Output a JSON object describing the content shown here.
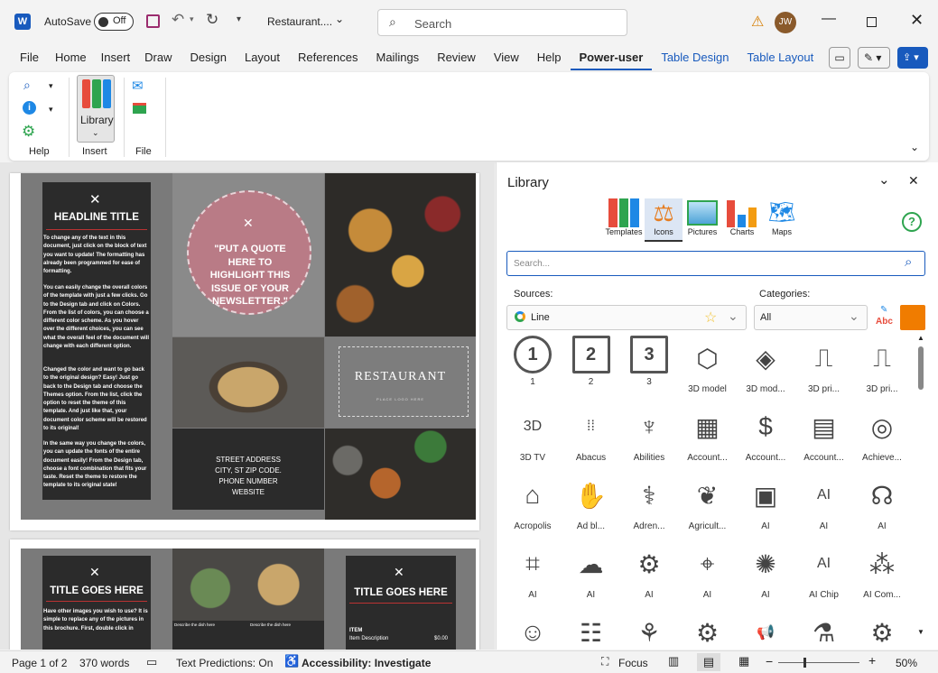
{
  "titlebar": {
    "autosave_label": "AutoSave",
    "autosave_state": "Off",
    "doc_title": "Restaurant....",
    "search_placeholder": "Search",
    "user_initials": "JW"
  },
  "menu": {
    "items": [
      "File",
      "Home",
      "Insert",
      "Draw",
      "Design",
      "Layout",
      "References",
      "Mailings",
      "Review",
      "View",
      "Help",
      "Power-user",
      "Table Design",
      "Table Layout"
    ]
  },
  "ribbon": {
    "groups": [
      {
        "label": "Help"
      },
      {
        "label": "Insert"
      },
      {
        "label": "File"
      }
    ],
    "library_label": "Library"
  },
  "document": {
    "headline": "HEADLINE TITLE",
    "body_text": [
      "To change any of the text in this document, just click on the block of text you want to update! The formatting has already been programmed for ease of formatting.",
      "You can easily change the overall colors of the template with just a few clicks. Go to the Design tab and click on Colors. From the list of colors, you can choose a different color scheme. As you hover over the different choices, you can see what the overall feel of the document will change with each different option.",
      "Changed the color and want to go back to the original design? Easy! Just go back to the Design tab and choose the Themes option. From the list, click the option to reset the theme of this template. And just like that, your document color scheme will be restored to its original!",
      "In the same way you change the colors, you can update the fonts of the entire document easily! From the Design tab, choose a font combination that fits your taste. Reset the theme to restore the template to its original state!"
    ],
    "quote": "\"PUT A QUOTE HERE TO HIGHLIGHT THIS ISSUE OF YOUR NEWSLETTER.\"",
    "restaurant": "RESTAURANT",
    "logo_sub": "PLACE LOGO HERE",
    "address": [
      "STREET ADDRESS",
      "CITY, ST ZIP CODE.",
      "PHONE NUMBER",
      "WEBSITE"
    ],
    "page2_title_left": "TITLE GOES HERE",
    "page2_title_right": "TITLE GOES HERE",
    "page2_text": "Have other images you wish to use? It is simple to replace any of the pictures in this brochure. First, double click in",
    "dish1": "Describe the dish here",
    "dish2": "Describe the dish here",
    "item_label": "ITEM",
    "item_desc": "Item Description",
    "item_price": "$0.00"
  },
  "library": {
    "title": "Library",
    "tabs": [
      "Templates",
      "Icons",
      "Pictures",
      "Charts",
      "Maps"
    ],
    "search_placeholder": "Search...",
    "sources_label": "Sources:",
    "categories_label": "Categories:",
    "source_value": "Line",
    "category_value": "All",
    "abc_label": "Abc",
    "icons": [
      {
        "label": "1",
        "glyph": "1"
      },
      {
        "label": "2",
        "glyph": "2"
      },
      {
        "label": "3",
        "glyph": "3"
      },
      {
        "label": "3D model",
        "glyph": "⬡"
      },
      {
        "label": "3D mod...",
        "glyph": "◈"
      },
      {
        "label": "3D pri...",
        "glyph": "⎍"
      },
      {
        "label": "3D pri...",
        "glyph": "⎍"
      },
      {
        "label": "3D TV",
        "glyph": "3D"
      },
      {
        "label": "Abacus",
        "glyph": "⁞⁞"
      },
      {
        "label": "Abilities",
        "glyph": "♆"
      },
      {
        "label": "Account...",
        "glyph": "▦"
      },
      {
        "label": "Account...",
        "glyph": "$"
      },
      {
        "label": "Account...",
        "glyph": "▤"
      },
      {
        "label": "Achieve...",
        "glyph": "◎"
      },
      {
        "label": "Acropolis",
        "glyph": "⌂"
      },
      {
        "label": "Ad bl...",
        "glyph": "✋"
      },
      {
        "label": "Adren...",
        "glyph": "⚕"
      },
      {
        "label": "Agricult...",
        "glyph": "❦"
      },
      {
        "label": "AI",
        "glyph": "▣"
      },
      {
        "label": "AI",
        "glyph": "AI"
      },
      {
        "label": "AI",
        "glyph": "☊"
      },
      {
        "label": "AI",
        "glyph": "⌗"
      },
      {
        "label": "AI",
        "glyph": "☁"
      },
      {
        "label": "AI",
        "glyph": "⚙"
      },
      {
        "label": "AI",
        "glyph": "⌖"
      },
      {
        "label": "AI",
        "glyph": "✺"
      },
      {
        "label": "AI Chip",
        "glyph": "AI"
      },
      {
        "label": "AI Com...",
        "glyph": "⁂"
      },
      {
        "label": "",
        "glyph": "☺"
      },
      {
        "label": "",
        "glyph": "☷"
      },
      {
        "label": "",
        "glyph": "⚘"
      },
      {
        "label": "",
        "glyph": "⚙"
      },
      {
        "label": "",
        "glyph": "📢"
      },
      {
        "label": "",
        "glyph": "⚗"
      },
      {
        "label": "",
        "glyph": "⚙"
      }
    ]
  },
  "status": {
    "page": "Page 1 of 2",
    "words": "370 words",
    "predictions": "Text Predictions: On",
    "accessibility": "Accessibility: Investigate",
    "focus": "Focus",
    "zoom": "50%"
  },
  "colors": {
    "accent": "#185abd",
    "word_blue": "#185abd",
    "orange": "#f07c00",
    "quote_pink": "#b97b86"
  }
}
